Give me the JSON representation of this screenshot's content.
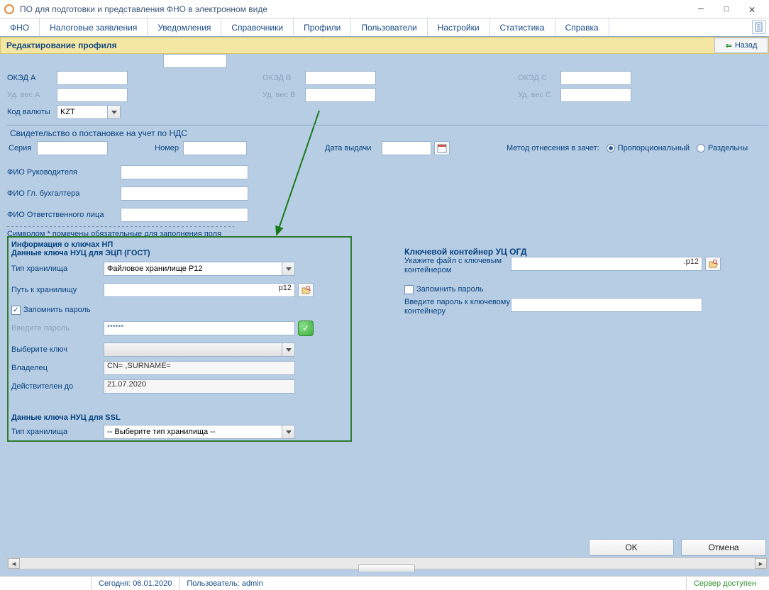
{
  "titlebar": {
    "title": "ПО для подготовки и представления ФНО в электронном виде"
  },
  "menu": [
    "ФНО",
    "Налоговые заявления",
    "Уведомления",
    "Справочники",
    "Профили",
    "Пользователи",
    "Настройки",
    "Статистика",
    "Справка"
  ],
  "panel": {
    "title": "Редактирование профиля",
    "back": "Назад"
  },
  "oked": {
    "a_label": "ОКЭД А",
    "a_weight": "Уд. вес А",
    "b_label": "ОКЭД В",
    "b_weight": "Уд. вес В",
    "c_label": "ОКЭД С",
    "c_weight": "Уд. вес С"
  },
  "currency": {
    "label": "Код валюты",
    "value": "KZT"
  },
  "vat": {
    "title": "Свидетельство о постановке на учет по НДС",
    "series": "Серия",
    "number": "Номер",
    "date": "Дата выдачи",
    "method": "Метод отнесения в зачет:",
    "opt1": "Пропорциональный",
    "opt2": "Раздельны"
  },
  "fio": {
    "head": "ФИО Руководителя",
    "acc": "ФИО Гл. бухгалтера",
    "resp": "ФИО Ответственного лица"
  },
  "note": "Символом * помечены обязательные для заполнения поля",
  "keys": {
    "title": "Информация о ключах НП",
    "gost_title": "Данные ключа НУЦ для ЭЦП (ГОСТ)",
    "storage_label": "Тип хранилища",
    "storage_value": "Файловое хранилище P12",
    "path_label": "Путь к хранилищу",
    "path_suffix": "p12",
    "remember": "Запомнить пароль",
    "pwd_label": "Введите пароль",
    "pwd_value": "••••••",
    "select_key": "Выберите ключ",
    "owner_label": "Владелец",
    "owner_value": "CN=                         ,SURNAME=",
    "valid_label": "Действителен до",
    "valid_value": "21.07.2020",
    "ssl_title": "Данные ключа НУЦ для SSL",
    "ssl_storage_value": "-- Выберите тип хранилища --"
  },
  "right": {
    "title": "Ключевой контейнер УЦ ОГД",
    "file_label": "Укажите файл с ключевым контейнером",
    "file_suffix": ".p12",
    "remember": "Запомнить пароль",
    "pwd_label": "Введите пароль к ключевому контейнеру"
  },
  "buttons": {
    "ok": "OK",
    "cancel": "Отмена"
  },
  "status": {
    "date": "Сегодня: 06.01.2020",
    "user": "Пользователь: admin",
    "server": "Сервер доступен"
  }
}
